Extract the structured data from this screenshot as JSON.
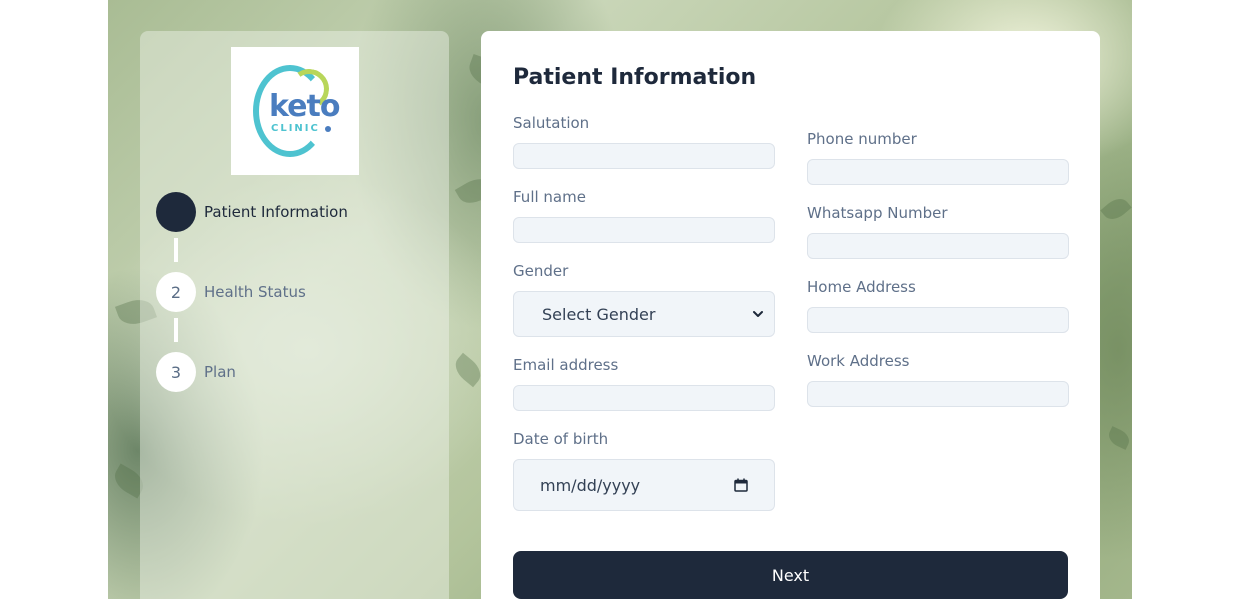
{
  "logo": {
    "word": "keto",
    "sub": "CLINIC"
  },
  "steps": [
    {
      "number": "",
      "label": "Patient Information",
      "active": true
    },
    {
      "number": "2",
      "label": "Health Status",
      "active": false
    },
    {
      "number": "3",
      "label": "Plan",
      "active": false
    }
  ],
  "form": {
    "title": "Patient Information",
    "salutation": {
      "label": "Salutation",
      "value": ""
    },
    "full_name": {
      "label": "Full name",
      "value": ""
    },
    "gender": {
      "label": "Gender",
      "selected": "Select Gender"
    },
    "email": {
      "label": "Email address",
      "value": ""
    },
    "dob": {
      "label": "Date of birth",
      "placeholder": "mm/dd/yyyy"
    },
    "phone": {
      "label": "Phone number",
      "value": ""
    },
    "whatsapp": {
      "label": "Whatsapp Number",
      "value": ""
    },
    "home_address": {
      "label": "Home Address",
      "value": ""
    },
    "work_address": {
      "label": "Work Address",
      "value": ""
    },
    "next_label": "Next"
  },
  "colors": {
    "primary": "#1e293b",
    "input_bg": "#f1f5f9",
    "label": "#5f7089",
    "logo_blue": "#4a7dbf",
    "logo_teal": "#4ec3d0",
    "logo_green": "#b8d65a"
  }
}
